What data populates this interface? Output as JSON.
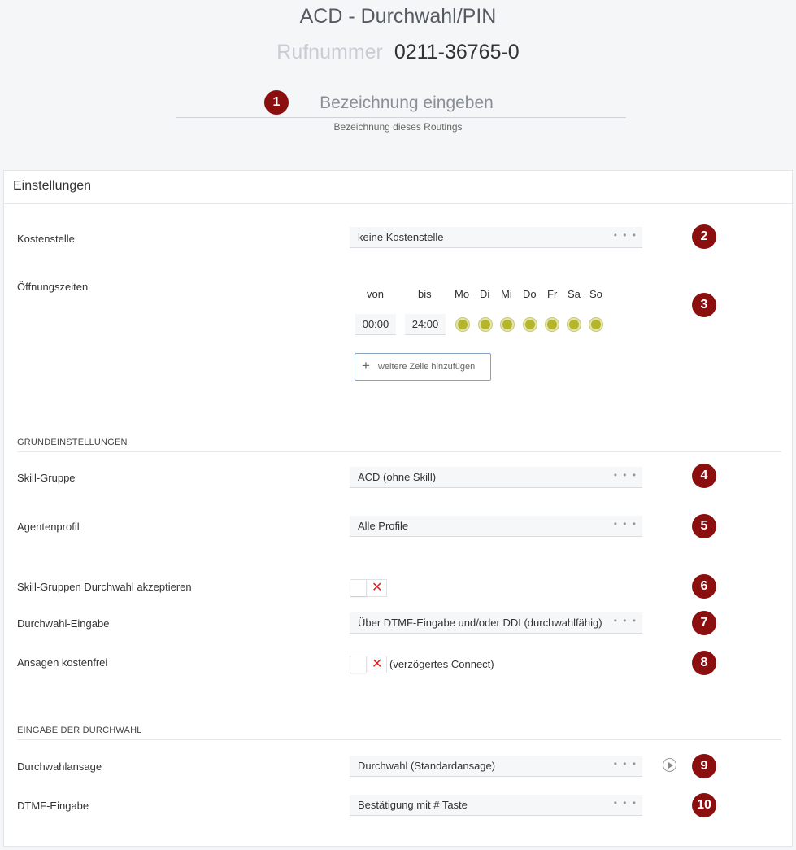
{
  "header": {
    "title": "ACD - Durchwahl/PIN",
    "rufnummer_label": "Rufnummer",
    "rufnummer_value": "0211-36765-0",
    "name_placeholder": "Bezeichnung eingeben",
    "name_hint": "Bezeichnung dieses Routings"
  },
  "badges": [
    "1",
    "2",
    "3",
    "4",
    "5",
    "6",
    "7",
    "8",
    "9",
    "10"
  ],
  "badge_color": "#8b0f0f",
  "settings": {
    "title": "Einstellungen",
    "kostenstelle": {
      "label": "Kostenstelle",
      "value": "keine Kostenstelle"
    },
    "oeffnungszeiten": {
      "label": "Öffnungszeiten",
      "col_von": "von",
      "col_bis": "bis",
      "days": [
        "Mo",
        "Di",
        "Mi",
        "Do",
        "Fr",
        "Sa",
        "So"
      ],
      "rows": [
        {
          "von": "00:00",
          "bis": "24:00",
          "days_active": [
            true,
            true,
            true,
            true,
            true,
            true,
            true
          ]
        }
      ],
      "add_row_label": "weitere Zeile hinzufügen",
      "active_day_color": "#b5b52a"
    }
  },
  "grundeinstellungen": {
    "section_title": "GRUNDEINSTELLUNGEN",
    "skill_gruppe": {
      "label": "Skill-Gruppe",
      "value": "ACD (ohne Skill)"
    },
    "agentenprofil": {
      "label": "Agentenprofil",
      "value": "Alle Profile"
    },
    "skill_durchwahl": {
      "label": "Skill-Gruppen Durchwahl akzeptieren",
      "enabled": false
    },
    "durchwahl_eingabe": {
      "label": "Durchwahl-Eingabe",
      "value": "Über DTMF-Eingabe und/oder DDI (durchwahlfähig)"
    },
    "ansagen_kostenfrei": {
      "label": "Ansagen kostenfrei",
      "enabled": false,
      "note": "(verzögertes Connect)"
    }
  },
  "eingabe_durchwahl": {
    "section_title": "EINGABE DER DURCHWAHL",
    "durchwahlansage": {
      "label": "Durchwahlansage",
      "value": "Durchwahl (Standardansage)"
    },
    "dtmf_eingabe": {
      "label": "DTMF-Eingabe",
      "value": "Bestätigung mit # Taste"
    }
  },
  "ui": {
    "more_dots": "• • •",
    "toggle_off_glyph": "✕",
    "plus_glyph": "+"
  }
}
